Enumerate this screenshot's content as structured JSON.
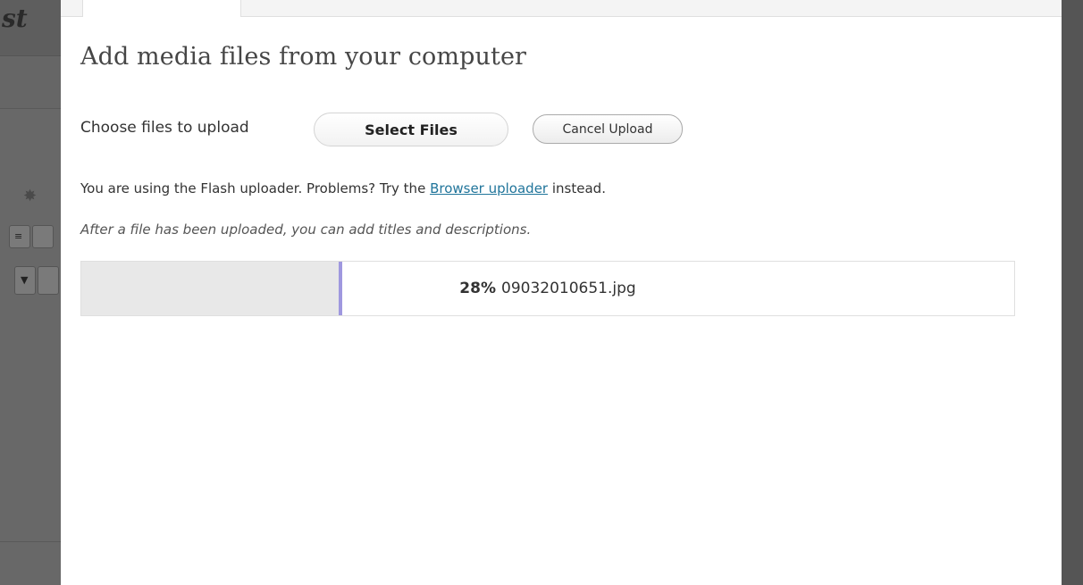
{
  "background": {
    "title_fragment": "st",
    "gear_icon": "gear-icon",
    "dropdown_arrow_icon": "caret-down-icon"
  },
  "dialog": {
    "title": "Add media files from your computer",
    "choose_label": "Choose files to upload",
    "select_files_label": "Select Files",
    "cancel_upload_label": "Cancel Upload",
    "flash_note": {
      "before": "You are using the Flash uploader. Problems? Try the ",
      "link": "Browser uploader",
      "after": " instead."
    },
    "after_note": "After a file has been uploaded, you can add titles and descriptions.",
    "upload": {
      "percent_label": "28%",
      "percent_value": 28,
      "filename": "09032010651.jpg"
    }
  },
  "colors": {
    "link": "#21759b",
    "progress_bar_edge": "#9f98df",
    "progress_fill": "#e8e8e8"
  }
}
